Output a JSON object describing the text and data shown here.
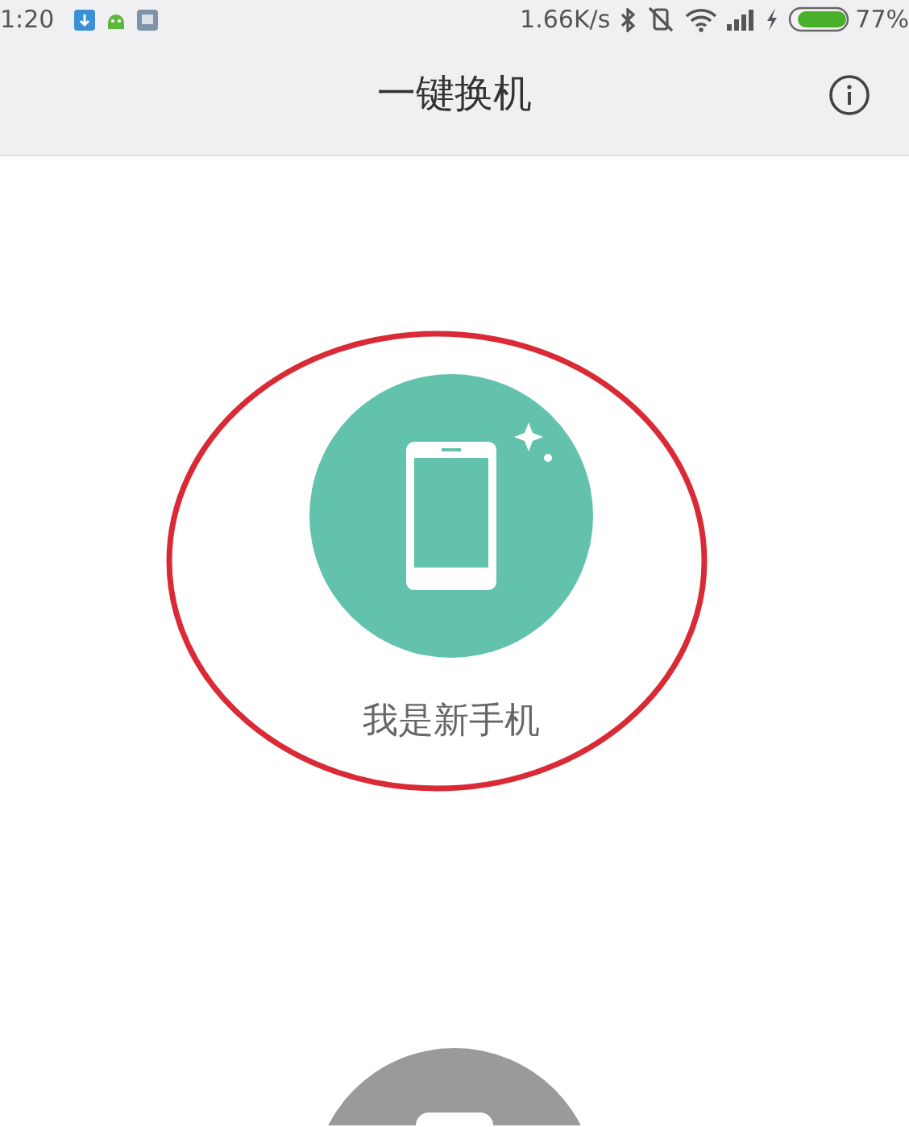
{
  "status_bar": {
    "time": "1:20",
    "speed": "1.66K/s",
    "battery": "77%"
  },
  "header": {
    "title": "一键换机"
  },
  "options": [
    {
      "kind": "new",
      "label": "我是新手机"
    },
    {
      "kind": "old"
    }
  ]
}
